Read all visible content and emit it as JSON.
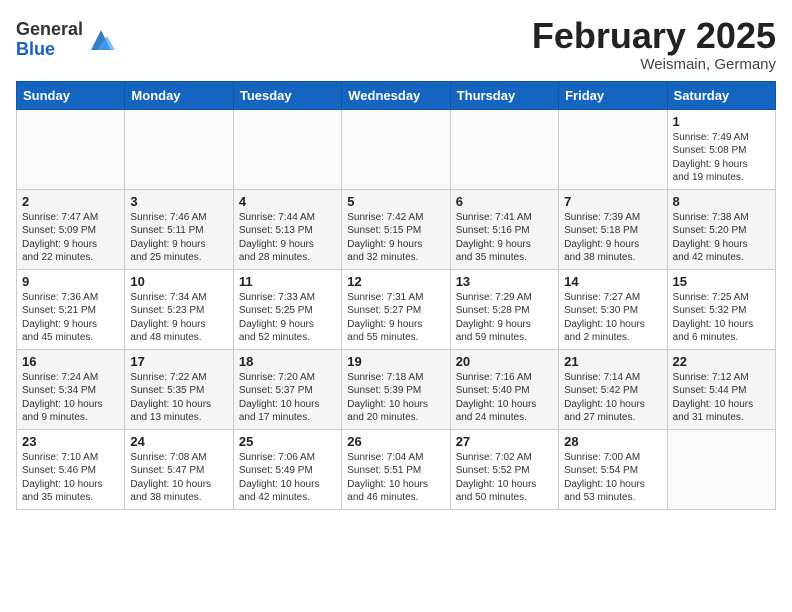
{
  "header": {
    "logo_general": "General",
    "logo_blue": "Blue",
    "month_title": "February 2025",
    "location": "Weismain, Germany"
  },
  "weekdays": [
    "Sunday",
    "Monday",
    "Tuesday",
    "Wednesday",
    "Thursday",
    "Friday",
    "Saturday"
  ],
  "weeks": [
    [
      {
        "day": "",
        "info": ""
      },
      {
        "day": "",
        "info": ""
      },
      {
        "day": "",
        "info": ""
      },
      {
        "day": "",
        "info": ""
      },
      {
        "day": "",
        "info": ""
      },
      {
        "day": "",
        "info": ""
      },
      {
        "day": "1",
        "info": "Sunrise: 7:49 AM\nSunset: 5:08 PM\nDaylight: 9 hours\nand 19 minutes."
      }
    ],
    [
      {
        "day": "2",
        "info": "Sunrise: 7:47 AM\nSunset: 5:09 PM\nDaylight: 9 hours\nand 22 minutes."
      },
      {
        "day": "3",
        "info": "Sunrise: 7:46 AM\nSunset: 5:11 PM\nDaylight: 9 hours\nand 25 minutes."
      },
      {
        "day": "4",
        "info": "Sunrise: 7:44 AM\nSunset: 5:13 PM\nDaylight: 9 hours\nand 28 minutes."
      },
      {
        "day": "5",
        "info": "Sunrise: 7:42 AM\nSunset: 5:15 PM\nDaylight: 9 hours\nand 32 minutes."
      },
      {
        "day": "6",
        "info": "Sunrise: 7:41 AM\nSunset: 5:16 PM\nDaylight: 9 hours\nand 35 minutes."
      },
      {
        "day": "7",
        "info": "Sunrise: 7:39 AM\nSunset: 5:18 PM\nDaylight: 9 hours\nand 38 minutes."
      },
      {
        "day": "8",
        "info": "Sunrise: 7:38 AM\nSunset: 5:20 PM\nDaylight: 9 hours\nand 42 minutes."
      }
    ],
    [
      {
        "day": "9",
        "info": "Sunrise: 7:36 AM\nSunset: 5:21 PM\nDaylight: 9 hours\nand 45 minutes."
      },
      {
        "day": "10",
        "info": "Sunrise: 7:34 AM\nSunset: 5:23 PM\nDaylight: 9 hours\nand 48 minutes."
      },
      {
        "day": "11",
        "info": "Sunrise: 7:33 AM\nSunset: 5:25 PM\nDaylight: 9 hours\nand 52 minutes."
      },
      {
        "day": "12",
        "info": "Sunrise: 7:31 AM\nSunset: 5:27 PM\nDaylight: 9 hours\nand 55 minutes."
      },
      {
        "day": "13",
        "info": "Sunrise: 7:29 AM\nSunset: 5:28 PM\nDaylight: 9 hours\nand 59 minutes."
      },
      {
        "day": "14",
        "info": "Sunrise: 7:27 AM\nSunset: 5:30 PM\nDaylight: 10 hours\nand 2 minutes."
      },
      {
        "day": "15",
        "info": "Sunrise: 7:25 AM\nSunset: 5:32 PM\nDaylight: 10 hours\nand 6 minutes."
      }
    ],
    [
      {
        "day": "16",
        "info": "Sunrise: 7:24 AM\nSunset: 5:34 PM\nDaylight: 10 hours\nand 9 minutes."
      },
      {
        "day": "17",
        "info": "Sunrise: 7:22 AM\nSunset: 5:35 PM\nDaylight: 10 hours\nand 13 minutes."
      },
      {
        "day": "18",
        "info": "Sunrise: 7:20 AM\nSunset: 5:37 PM\nDaylight: 10 hours\nand 17 minutes."
      },
      {
        "day": "19",
        "info": "Sunrise: 7:18 AM\nSunset: 5:39 PM\nDaylight: 10 hours\nand 20 minutes."
      },
      {
        "day": "20",
        "info": "Sunrise: 7:16 AM\nSunset: 5:40 PM\nDaylight: 10 hours\nand 24 minutes."
      },
      {
        "day": "21",
        "info": "Sunrise: 7:14 AM\nSunset: 5:42 PM\nDaylight: 10 hours\nand 27 minutes."
      },
      {
        "day": "22",
        "info": "Sunrise: 7:12 AM\nSunset: 5:44 PM\nDaylight: 10 hours\nand 31 minutes."
      }
    ],
    [
      {
        "day": "23",
        "info": "Sunrise: 7:10 AM\nSunset: 5:46 PM\nDaylight: 10 hours\nand 35 minutes."
      },
      {
        "day": "24",
        "info": "Sunrise: 7:08 AM\nSunset: 5:47 PM\nDaylight: 10 hours\nand 38 minutes."
      },
      {
        "day": "25",
        "info": "Sunrise: 7:06 AM\nSunset: 5:49 PM\nDaylight: 10 hours\nand 42 minutes."
      },
      {
        "day": "26",
        "info": "Sunrise: 7:04 AM\nSunset: 5:51 PM\nDaylight: 10 hours\nand 46 minutes."
      },
      {
        "day": "27",
        "info": "Sunrise: 7:02 AM\nSunset: 5:52 PM\nDaylight: 10 hours\nand 50 minutes."
      },
      {
        "day": "28",
        "info": "Sunrise: 7:00 AM\nSunset: 5:54 PM\nDaylight: 10 hours\nand 53 minutes."
      },
      {
        "day": "",
        "info": ""
      }
    ]
  ]
}
